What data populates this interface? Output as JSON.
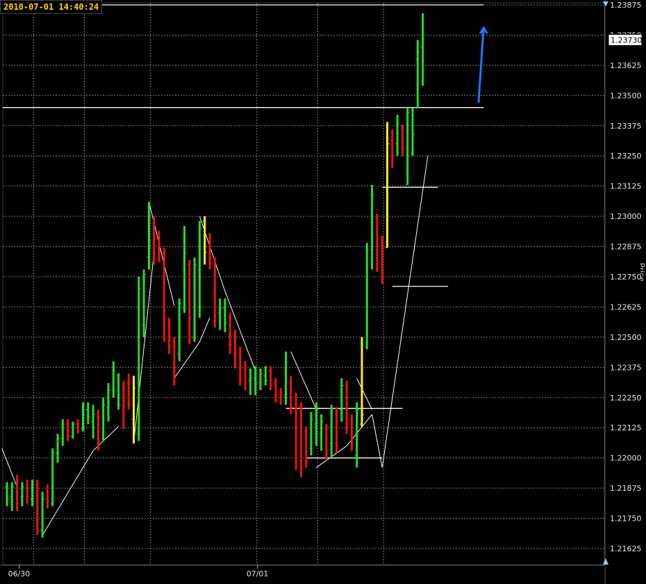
{
  "timestamp": "2010-07-01 14:40:24",
  "axis_title_fragment": "Price",
  "colors": {
    "background": "#000000",
    "grid": "#7a7a7a",
    "up_bar": "#22dd22",
    "down_bar": "#ee1111",
    "inside_bar": "#ffee22",
    "swing_line": "#ffffff",
    "level_line": "#ffffff",
    "projection_arrow": "#2277ff",
    "current_price_box": "#ffffff"
  },
  "chart_data": {
    "type": "ohlc-bar",
    "title": "",
    "xlabel": "",
    "ylabel": "Price",
    "grid": true,
    "ylim": [
      1.2158,
      1.2393
    ],
    "price_ticks": [
      "1.23875",
      "1.23750",
      "1.23625",
      "1.23500",
      "1.23375",
      "1.23250",
      "1.23125",
      "1.23000",
      "1.22875",
      "1.22750",
      "1.22625",
      "1.22500",
      "1.22375",
      "1.22250",
      "1.22125",
      "1.22000",
      "1.21875",
      "1.21750",
      "1.21625"
    ],
    "current_price": "1.23730",
    "date_labels": [
      {
        "label": "06/30",
        "bar": 2
      },
      {
        "label": "07/01",
        "bar": 49
      }
    ],
    "bars": [
      {
        "o": 1.2188,
        "h": 1.219,
        "l": 1.218,
        "c": 1.2183,
        "s": "up"
      },
      {
        "o": 1.2184,
        "h": 1.219,
        "l": 1.2178,
        "c": 1.2188,
        "s": "up"
      },
      {
        "o": 1.2186,
        "h": 1.2193,
        "l": 1.2178,
        "c": 1.2181,
        "s": "down"
      },
      {
        "o": 1.2184,
        "h": 1.219,
        "l": 1.218,
        "c": 1.2188,
        "s": "up"
      },
      {
        "o": 1.2189,
        "h": 1.2191,
        "l": 1.2181,
        "c": 1.2184,
        "s": "down"
      },
      {
        "o": 1.2183,
        "h": 1.2191,
        "l": 1.218,
        "c": 1.2189,
        "s": "up"
      },
      {
        "o": 1.2189,
        "h": 1.2191,
        "l": 1.2168,
        "c": 1.217,
        "s": "down"
      },
      {
        "o": 1.217,
        "h": 1.2186,
        "l": 1.2167,
        "c": 1.2183,
        "s": "up"
      },
      {
        "o": 1.2183,
        "h": 1.2189,
        "l": 1.2179,
        "c": 1.2182,
        "s": "down"
      },
      {
        "o": 1.2181,
        "h": 1.2204,
        "l": 1.218,
        "c": 1.2202,
        "s": "up"
      },
      {
        "o": 1.2202,
        "h": 1.221,
        "l": 1.2198,
        "c": 1.2208,
        "s": "up"
      },
      {
        "o": 1.2208,
        "h": 1.2216,
        "l": 1.2205,
        "c": 1.2214,
        "s": "up"
      },
      {
        "o": 1.2214,
        "h": 1.2216,
        "l": 1.2207,
        "c": 1.2209,
        "s": "down"
      },
      {
        "o": 1.2209,
        "h": 1.2215,
        "l": 1.2208,
        "c": 1.2214,
        "s": "up"
      },
      {
        "o": 1.2214,
        "h": 1.2216,
        "l": 1.221,
        "c": 1.2211,
        "s": "down"
      },
      {
        "o": 1.2212,
        "h": 1.2223,
        "l": 1.2211,
        "c": 1.222,
        "s": "up"
      },
      {
        "o": 1.222,
        "h": 1.2223,
        "l": 1.2214,
        "c": 1.2217,
        "s": "up"
      },
      {
        "o": 1.2215,
        "h": 1.2222,
        "l": 1.2208,
        "c": 1.2218,
        "s": "up"
      },
      {
        "o": 1.2217,
        "h": 1.222,
        "l": 1.2203,
        "c": 1.2207,
        "s": "down"
      },
      {
        "o": 1.2208,
        "h": 1.2225,
        "l": 1.2207,
        "c": 1.2222,
        "s": "up"
      },
      {
        "o": 1.2221,
        "h": 1.2231,
        "l": 1.2215,
        "c": 1.2228,
        "s": "up"
      },
      {
        "o": 1.2228,
        "h": 1.224,
        "l": 1.2225,
        "c": 1.2236,
        "s": "up"
      },
      {
        "o": 1.2234,
        "h": 1.2235,
        "l": 1.222,
        "c": 1.2222,
        "s": "up"
      },
      {
        "o": 1.2222,
        "h": 1.2232,
        "l": 1.2212,
        "c": 1.2229,
        "s": "down"
      },
      {
        "o": 1.2231,
        "h": 1.2235,
        "l": 1.222,
        "c": 1.2222,
        "s": "down"
      },
      {
        "o": 1.2216,
        "h": 1.2234,
        "l": 1.2206,
        "c": 1.2229,
        "s": "in"
      },
      {
        "o": 1.221,
        "h": 1.2275,
        "l": 1.2207,
        "c": 1.227,
        "s": "up"
      },
      {
        "o": 1.2255,
        "h": 1.2278,
        "l": 1.225,
        "c": 1.2276,
        "s": "up"
      },
      {
        "o": 1.2283,
        "h": 1.2306,
        "l": 1.2278,
        "c": 1.229,
        "s": "up"
      },
      {
        "o": 1.2299,
        "h": 1.23,
        "l": 1.228,
        "c": 1.2285,
        "s": "down"
      },
      {
        "o": 1.2292,
        "h": 1.2294,
        "l": 1.2281,
        "c": 1.2283,
        "s": "down"
      },
      {
        "o": 1.2285,
        "h": 1.2287,
        "l": 1.2248,
        "c": 1.225,
        "s": "down"
      },
      {
        "o": 1.2255,
        "h": 1.2258,
        "l": 1.2243,
        "c": 1.2246,
        "s": "down"
      },
      {
        "o": 1.2248,
        "h": 1.225,
        "l": 1.223,
        "c": 1.2233,
        "s": "down"
      },
      {
        "o": 1.2243,
        "h": 1.2266,
        "l": 1.224,
        "c": 1.2264,
        "s": "up"
      },
      {
        "o": 1.2262,
        "h": 1.2296,
        "l": 1.226,
        "c": 1.2285,
        "s": "up"
      },
      {
        "o": 1.228,
        "h": 1.2282,
        "l": 1.2247,
        "c": 1.225,
        "s": "down"
      },
      {
        "o": 1.225,
        "h": 1.2283,
        "l": 1.2248,
        "c": 1.228,
        "s": "up"
      },
      {
        "o": 1.2278,
        "h": 1.2298,
        "l": 1.2258,
        "c": 1.2295,
        "s": "up"
      },
      {
        "o": 1.2298,
        "h": 1.23,
        "l": 1.228,
        "c": 1.2285,
        "s": "in"
      },
      {
        "o": 1.229,
        "h": 1.2293,
        "l": 1.2278,
        "c": 1.2283,
        "s": "down"
      },
      {
        "o": 1.2281,
        "h": 1.2283,
        "l": 1.2254,
        "c": 1.2258,
        "s": "down"
      },
      {
        "o": 1.226,
        "h": 1.2266,
        "l": 1.2253,
        "c": 1.2262,
        "s": "up"
      },
      {
        "o": 1.2262,
        "h": 1.2266,
        "l": 1.2252,
        "c": 1.2256,
        "s": "up"
      },
      {
        "o": 1.2258,
        "h": 1.226,
        "l": 1.2243,
        "c": 1.2247,
        "s": "down"
      },
      {
        "o": 1.225,
        "h": 1.2253,
        "l": 1.2237,
        "c": 1.224,
        "s": "down"
      },
      {
        "o": 1.2243,
        "h": 1.2246,
        "l": 1.223,
        "c": 1.2233,
        "s": "down"
      },
      {
        "o": 1.2237,
        "h": 1.224,
        "l": 1.2228,
        "c": 1.2231,
        "s": "down"
      },
      {
        "o": 1.2232,
        "h": 1.2237,
        "l": 1.2226,
        "c": 1.2233,
        "s": "up"
      },
      {
        "o": 1.2233,
        "h": 1.2238,
        "l": 1.2226,
        "c": 1.2231,
        "s": "up"
      },
      {
        "o": 1.2231,
        "h": 1.2237,
        "l": 1.2228,
        "c": 1.2235,
        "s": "up"
      },
      {
        "o": 1.2234,
        "h": 1.2238,
        "l": 1.223,
        "c": 1.2232,
        "s": "up"
      },
      {
        "o": 1.2236,
        "h": 1.2238,
        "l": 1.2228,
        "c": 1.223,
        "s": "down"
      },
      {
        "o": 1.2231,
        "h": 1.2233,
        "l": 1.2223,
        "c": 1.2226,
        "s": "down"
      },
      {
        "o": 1.2225,
        "h": 1.2229,
        "l": 1.2222,
        "c": 1.2227,
        "s": "down"
      },
      {
        "o": 1.2226,
        "h": 1.2244,
        "l": 1.2222,
        "c": 1.224,
        "s": "up"
      },
      {
        "o": 1.2231,
        "h": 1.2234,
        "l": 1.2218,
        "c": 1.2221,
        "s": "down"
      },
      {
        "o": 1.2225,
        "h": 1.2227,
        "l": 1.2195,
        "c": 1.2198,
        "s": "down"
      },
      {
        "o": 1.2221,
        "h": 1.2223,
        "l": 1.2192,
        "c": 1.2196,
        "s": "down"
      },
      {
        "o": 1.2211,
        "h": 1.2213,
        "l": 1.2196,
        "c": 1.2199,
        "s": "down"
      },
      {
        "o": 1.2204,
        "h": 1.2219,
        "l": 1.2201,
        "c": 1.2216,
        "s": "up"
      },
      {
        "o": 1.2214,
        "h": 1.2223,
        "l": 1.2205,
        "c": 1.222,
        "s": "up"
      },
      {
        "o": 1.221,
        "h": 1.2218,
        "l": 1.2203,
        "c": 1.2215,
        "s": "up"
      },
      {
        "o": 1.2212,
        "h": 1.2214,
        "l": 1.2199,
        "c": 1.2203,
        "s": "down"
      },
      {
        "o": 1.2206,
        "h": 1.2222,
        "l": 1.22,
        "c": 1.2219,
        "s": "up"
      },
      {
        "o": 1.2218,
        "h": 1.2221,
        "l": 1.2202,
        "c": 1.2205,
        "s": "down"
      },
      {
        "o": 1.222,
        "h": 1.2233,
        "l": 1.2215,
        "c": 1.223,
        "s": "up"
      },
      {
        "o": 1.223,
        "h": 1.2232,
        "l": 1.221,
        "c": 1.2214,
        "s": "down"
      },
      {
        "o": 1.2216,
        "h": 1.2218,
        "l": 1.2203,
        "c": 1.2206,
        "s": "down"
      },
      {
        "o": 1.2201,
        "h": 1.2223,
        "l": 1.2196,
        "c": 1.222,
        "s": "up"
      },
      {
        "o": 1.2214,
        "h": 1.225,
        "l": 1.2213,
        "c": 1.2218,
        "s": "in"
      },
      {
        "o": 1.2246,
        "h": 1.2289,
        "l": 1.2245,
        "c": 1.2286,
        "s": "up"
      },
      {
        "o": 1.2283,
        "h": 1.2313,
        "l": 1.2278,
        "c": 1.2309,
        "s": "up"
      },
      {
        "o": 1.2299,
        "h": 1.2301,
        "l": 1.2277,
        "c": 1.2281,
        "s": "down"
      },
      {
        "o": 1.229,
        "h": 1.2292,
        "l": 1.2272,
        "c": 1.2275,
        "s": "down"
      },
      {
        "o": 1.2287,
        "h": 1.2339,
        "l": 1.2287,
        "c": 1.233,
        "s": "in"
      },
      {
        "o": 1.233,
        "h": 1.2336,
        "l": 1.232,
        "c": 1.2325,
        "s": "down"
      },
      {
        "o": 1.233,
        "h": 1.2342,
        "l": 1.2325,
        "c": 1.2338,
        "s": "up"
      },
      {
        "o": 1.2336,
        "h": 1.2338,
        "l": 1.2325,
        "c": 1.2328,
        "s": "down"
      },
      {
        "o": 1.2313,
        "h": 1.2345,
        "l": 1.2313,
        "c": 1.2343,
        "s": "up"
      },
      {
        "o": 1.2326,
        "h": 1.2345,
        "l": 1.2325,
        "c": 1.2334,
        "s": "up"
      },
      {
        "o": 1.2365,
        "h": 1.2373,
        "l": 1.2345,
        "c": 1.2368,
        "s": "up"
      },
      {
        "o": 1.237,
        "h": 1.2384,
        "l": 1.2354,
        "c": 1.2373,
        "s": "up"
      }
    ],
    "levels": [
      {
        "price": 1.23875,
        "from_bar": 12,
        "to_bar": 94
      },
      {
        "price": 1.2345,
        "from_bar": -1,
        "to_bar": 94
      },
      {
        "price": 1.2312,
        "from_bar": 74,
        "to_bar": 85
      },
      {
        "price": 1.2271,
        "from_bar": 76,
        "to_bar": 87
      },
      {
        "price": 1.22205,
        "from_bar": 55,
        "to_bar": 78
      },
      {
        "price": 1.22,
        "from_bar": 59,
        "to_bar": 74
      }
    ],
    "swing_points": [
      [
        -1,
        1.2204
      ],
      [
        2,
        1.2188
      ],
      [
        7,
        1.2168
      ],
      [
        17,
        1.2203
      ],
      [
        22,
        1.2213
      ],
      [
        25,
        1.2206
      ],
      [
        28,
        1.2306
      ],
      [
        33,
        1.2263
      ],
      [
        34,
        1.2233
      ],
      [
        38,
        1.2298
      ],
      [
        40,
        1.2281
      ],
      [
        43,
        1.227
      ],
      [
        49,
        1.2236
      ],
      [
        56,
        1.2244
      ],
      [
        61,
        1.2221
      ],
      [
        69,
        1.2233
      ],
      [
        72,
        1.2218
      ]
    ],
    "swing_segments": [
      [
        [
          -1,
          1.2204
        ],
        [
          2,
          1.2188
        ]
      ],
      [
        [
          7,
          1.2168
        ],
        [
          17,
          1.2203
        ]
      ],
      [
        [
          17,
          1.2203
        ],
        [
          22,
          1.2213
        ]
      ],
      [
        [
          25,
          1.2206
        ],
        [
          29,
          1.2285
        ]
      ],
      [
        [
          28,
          1.2306
        ],
        [
          33,
          1.2263
        ]
      ],
      [
        [
          33,
          1.2233
        ],
        [
          38,
          1.2248
        ]
      ],
      [
        [
          38,
          1.2248
        ],
        [
          40,
          1.2258
        ]
      ],
      [
        [
          38,
          1.23
        ],
        [
          43,
          1.2269
        ]
      ],
      [
        [
          43,
          1.2269
        ],
        [
          49,
          1.2236
        ]
      ],
      [
        [
          56,
          1.2244
        ],
        [
          61,
          1.222
        ]
      ],
      [
        [
          61,
          1.2196
        ],
        [
          67,
          1.2205
        ]
      ],
      [
        [
          67,
          1.2205
        ],
        [
          72,
          1.2218
        ]
      ],
      [
        [
          69,
          1.2233
        ],
        [
          72,
          1.222
        ]
      ],
      [
        [
          72,
          1.2218
        ],
        [
          74,
          1.2196
        ]
      ],
      [
        [
          74,
          1.2196
        ],
        [
          83,
          1.2325
        ]
      ]
    ],
    "projection_arrow": {
      "from": [
        93,
        1.2347
      ],
      "to": [
        94,
        1.2378
      ]
    }
  }
}
